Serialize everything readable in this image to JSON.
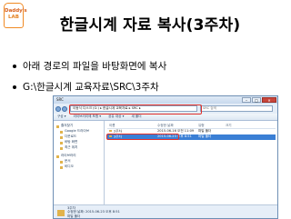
{
  "logo": {
    "line1": "Daddy's",
    "line2": "LAB"
  },
  "slide": {
    "title": "한글시계 자료 복사(3주차)",
    "bullets": [
      "아래 경로의 파일을 바탕화면에 복사",
      "G:\\한글시계 교육자료\\SRC\\3주차"
    ]
  },
  "explorer": {
    "window_title": "SRC",
    "address_path": "이동식 디스크 (G:) ▸ 한글시계 교육자료 ▸ SRC ▸",
    "search_placeholder": "SRC 검색",
    "toolbar": [
      "구성 ▾",
      "라이브러리에 포함 ▾",
      "공유 대상 ▾",
      "새 폴더"
    ],
    "nav": [
      {
        "label": "즐겨찾기",
        "level": 0
      },
      {
        "label": "Google 드라이브",
        "level": 1
      },
      {
        "label": "다운로드",
        "level": 1
      },
      {
        "label": "바탕 화면",
        "level": 1
      },
      {
        "label": "최근 위치",
        "level": 1
      },
      {
        "label": "라이브러리",
        "level": 0
      },
      {
        "label": "문서",
        "level": 1
      },
      {
        "label": "비디오",
        "level": 1
      }
    ],
    "columns": [
      "이름",
      "수정한 날짜",
      "유형",
      "크기"
    ],
    "files": [
      {
        "name": "2주차",
        "date": "2015-06-16 오전 11:09",
        "type": "파일 폴더",
        "size": ""
      },
      {
        "name": "3주차",
        "date": "2015-06-23 오후 8:51",
        "type": "파일 폴더",
        "size": ""
      }
    ],
    "selected_index": 1,
    "details": {
      "name": "3주차",
      "date_label": "수정한 날짜: 2015-06-23 오후 8:51",
      "type": "파일 폴더"
    }
  },
  "colors": {
    "highlight": "#e0302a",
    "selection": "#3a7fd5",
    "logo_accent": "#f08a24"
  }
}
